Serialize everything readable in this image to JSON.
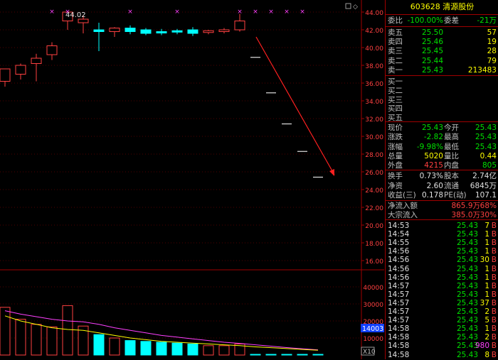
{
  "stock": {
    "code": "603628",
    "name": "清源股份"
  },
  "chart_labels": {
    "high_marker": "44.02",
    "volume_marker": "14003",
    "volume_scale": "X10"
  },
  "price_axis": [
    "44.00",
    "42.00",
    "40.00",
    "38.00",
    "36.00",
    "34.00",
    "32.00",
    "30.00",
    "28.00",
    "26.00",
    "24.00",
    "22.00",
    "20.00",
    "18.00",
    "16.00"
  ],
  "volume_axis": [
    "40000",
    "30000",
    "20000",
    "10000"
  ],
  "order_book": {
    "weibi_label": "委比",
    "weibi_value": "-100.00%",
    "weicha_label": "委差",
    "weicha_value": "-21万",
    "asks": [
      {
        "label": "卖五",
        "price": "25.50",
        "vol": "57"
      },
      {
        "label": "卖四",
        "price": "25.46",
        "vol": "19"
      },
      {
        "label": "卖三",
        "price": "25.45",
        "vol": "28"
      },
      {
        "label": "卖二",
        "price": "25.44",
        "vol": "79"
      },
      {
        "label": "卖一",
        "price": "25.43",
        "vol": "213483"
      }
    ],
    "bids": [
      {
        "label": "买一"
      },
      {
        "label": "买二"
      },
      {
        "label": "买三"
      },
      {
        "label": "买四"
      },
      {
        "label": "买五"
      }
    ]
  },
  "quote": [
    {
      "l1": "现价",
      "v1": "25.43",
      "l2": "今开",
      "v2": "25.43",
      "c1": "g",
      "c2": "g"
    },
    {
      "l1": "涨跌",
      "v1": "-2.82",
      "l2": "最高",
      "v2": "25.43",
      "c1": "g",
      "c2": "g"
    },
    {
      "l1": "涨幅",
      "v1": "-9.98%",
      "l2": "最低",
      "v2": "25.43",
      "c1": "g",
      "c2": "g"
    },
    {
      "l1": "总量",
      "v1": "5020",
      "l2": "量比",
      "v2": "0.44",
      "c1": "y",
      "c2": "y"
    },
    {
      "l1": "外盘",
      "v1": "4215",
      "l2": "内盘",
      "v2": "805",
      "c1": "r",
      "c2": "g"
    }
  ],
  "stats": [
    {
      "l1": "换手",
      "v1": "0.73%",
      "l2": "股本",
      "v2": "2.74亿"
    },
    {
      "l1": "净资",
      "v1": "2.60",
      "l2": "流通",
      "v2": "6845万"
    },
    {
      "l1": "收益(三)",
      "v1": "0.178",
      "l2": "PE(动)",
      "v2": "107.1"
    }
  ],
  "flows": [
    {
      "label": "净流入额",
      "value": "865.9万",
      "pct": "68%"
    },
    {
      "label": "大宗流入",
      "value": "385.0万",
      "pct": "30%"
    }
  ],
  "ticks": [
    {
      "time": "14:53",
      "price": "25.43",
      "vol": "7",
      "side": "B"
    },
    {
      "time": "14:54",
      "price": "25.43",
      "vol": "1",
      "side": "B"
    },
    {
      "time": "14:55",
      "price": "25.43",
      "vol": "1",
      "side": "B"
    },
    {
      "time": "14:56",
      "price": "25.43",
      "vol": "1",
      "side": "B"
    },
    {
      "time": "14:56",
      "price": "25.43",
      "vol": "30",
      "side": "B"
    },
    {
      "time": "14:56",
      "price": "25.43",
      "vol": "1",
      "side": "B"
    },
    {
      "time": "14:56",
      "price": "25.43",
      "vol": "1",
      "side": "B"
    },
    {
      "time": "14:57",
      "price": "25.43",
      "vol": "1",
      "side": "B"
    },
    {
      "time": "14:57",
      "price": "25.43",
      "vol": "1",
      "side": "B"
    },
    {
      "time": "14:57",
      "price": "25.43",
      "vol": "37",
      "side": "B"
    },
    {
      "time": "14:57",
      "price": "25.43",
      "vol": "2",
      "side": "B"
    },
    {
      "time": "14:57",
      "price": "25.43",
      "vol": "5",
      "side": "B"
    },
    {
      "time": "14:58",
      "price": "25.43",
      "vol": "1",
      "side": "B"
    },
    {
      "time": "14:58",
      "price": "25.43",
      "vol": "2",
      "side": "B"
    },
    {
      "time": "14:58",
      "price": "25.43",
      "vol": "980",
      "side": "B"
    },
    {
      "time": "14:58",
      "price": "25.43",
      "vol": "8",
      "side": "B"
    }
  ],
  "colors": {
    "up": "#ff4040",
    "down": "#00ffff",
    "flat": "#e0e0e0",
    "grid": "#a00000",
    "ma1": "#ffff00",
    "ma2": "#ff40ff",
    "arrow": "#ff2020"
  },
  "chart_data": {
    "type": "candlestick",
    "ylim": [
      16,
      44
    ],
    "candles": [
      {
        "o": 36.2,
        "c": 37.6,
        "h": 37.6,
        "l": 35.6
      },
      {
        "o": 37.0,
        "c": 38.0,
        "h": 38.2,
        "l": 36.4
      },
      {
        "o": 38.2,
        "c": 38.8,
        "h": 39.3,
        "l": 36.2
      },
      {
        "o": 39.2,
        "c": 40.2,
        "h": 40.6,
        "l": 38.6
      },
      {
        "o": 43.0,
        "c": 44.0,
        "h": 44.0,
        "l": 42.0
      },
      {
        "o": 42.8,
        "c": 43.2,
        "h": 43.6,
        "l": 41.6
      },
      {
        "o": 42.0,
        "c": 41.8,
        "h": 42.8,
        "l": 39.6
      },
      {
        "o": 41.8,
        "c": 42.2,
        "h": 42.3,
        "l": 41.2
      },
      {
        "o": 42.2,
        "c": 41.8,
        "h": 42.5,
        "l": 41.5
      },
      {
        "o": 42.0,
        "c": 41.6,
        "h": 42.2,
        "l": 41.4
      },
      {
        "o": 41.8,
        "c": 41.7,
        "h": 42.1,
        "l": 41.4
      },
      {
        "o": 41.9,
        "c": 41.8,
        "h": 42.1,
        "l": 41.5
      },
      {
        "o": 42.0,
        "c": 41.6,
        "h": 42.3,
        "l": 41.3
      },
      {
        "o": 41.7,
        "c": 41.9,
        "h": 42.0,
        "l": 41.5
      },
      {
        "o": 41.8,
        "c": 42.0,
        "h": 42.2,
        "l": 41.6
      },
      {
        "o": 42.0,
        "c": 43.0,
        "h": 43.8,
        "l": 41.8
      },
      {
        "o": 38.9,
        "c": 38.9,
        "h": 38.9,
        "l": 38.9
      },
      {
        "o": 34.9,
        "c": 34.9,
        "h": 34.9,
        "l": 34.9
      },
      {
        "o": 31.4,
        "c": 31.4,
        "h": 31.4,
        "l": 31.4
      },
      {
        "o": 28.3,
        "c": 28.3,
        "h": 28.3,
        "l": 28.3
      },
      {
        "o": 25.4,
        "c": 25.4,
        "h": 25.4,
        "l": 25.4
      }
    ],
    "volume_ylim": [
      0,
      45000
    ],
    "volumes": [
      28000,
      21000,
      18000,
      16500,
      29000,
      17000,
      12000,
      10000,
      8500,
      8000,
      7500,
      7000,
      6500,
      5500,
      5500,
      6500,
      400,
      400,
      400,
      400,
      400
    ],
    "ma_volume_1": [
      23000,
      20000,
      18000,
      16000,
      15000,
      14500,
      13000,
      11500,
      10000,
      9000,
      8000,
      7500,
      7000,
      6500,
      6000,
      5500,
      4800,
      4300,
      3800,
      3300,
      2800
    ],
    "ma_volume_2": [
      26000,
      24000,
      22500,
      21000,
      20000,
      19500,
      18000,
      16000,
      14500,
      13000,
      11500,
      10500,
      9500,
      8500,
      7500,
      6800,
      6000,
      5200,
      4400,
      3700,
      3000
    ]
  }
}
